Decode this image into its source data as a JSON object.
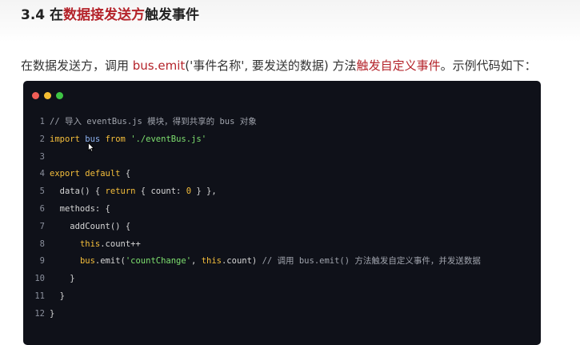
{
  "heading": {
    "prefix": "3.4 在",
    "highlight": "数据接发送方",
    "suffix": "触发事件"
  },
  "paragraph": {
    "part1": "在数据发送方，调用 ",
    "emit": "bus.emit",
    "part2": "('事件名称', 要发送的数据) 方法",
    "accent": "触发自定义事件",
    "part3": "。示例代码如下："
  },
  "colors": {
    "accent": "#b4232a",
    "code_bg": "#0f1119",
    "keyword": "#f6bf3b",
    "string": "#7ee06f",
    "identifier": "#8db2f0"
  },
  "code": {
    "lines": [
      {
        "num": "1",
        "tokens": [
          {
            "t": "// 导入 eventBus.js 模块，得到共享的 bus 对象",
            "c": "comment"
          }
        ]
      },
      {
        "num": "2",
        "tokens": [
          {
            "t": "import",
            "c": "kw"
          },
          {
            "t": " ",
            "c": "plain"
          },
          {
            "t": "bus",
            "c": "bus"
          },
          {
            "t": " ",
            "c": "plain"
          },
          {
            "t": "from",
            "c": "kw"
          },
          {
            "t": " ",
            "c": "plain"
          },
          {
            "t": "'./eventBus.js'",
            "c": "str"
          }
        ]
      },
      {
        "num": "3",
        "tokens": []
      },
      {
        "num": "4",
        "tokens": [
          {
            "t": "export default",
            "c": "kw"
          },
          {
            "t": " {",
            "c": "plain"
          }
        ]
      },
      {
        "num": "5",
        "tokens": [
          {
            "t": "  data() { ",
            "c": "plain"
          },
          {
            "t": "return",
            "c": "kw"
          },
          {
            "t": " { count: ",
            "c": "plain"
          },
          {
            "t": "0",
            "c": "num"
          },
          {
            "t": " } },",
            "c": "plain"
          }
        ]
      },
      {
        "num": "6",
        "tokens": [
          {
            "t": "  methods: {",
            "c": "plain"
          }
        ]
      },
      {
        "num": "7",
        "tokens": [
          {
            "t": "    addCount() {",
            "c": "plain"
          }
        ]
      },
      {
        "num": "8",
        "tokens": [
          {
            "t": "      ",
            "c": "plain"
          },
          {
            "t": "this",
            "c": "kw"
          },
          {
            "t": ".count++",
            "c": "plain"
          }
        ]
      },
      {
        "num": "9",
        "tokens": [
          {
            "t": "      ",
            "c": "plain"
          },
          {
            "t": "bus",
            "c": "kw"
          },
          {
            "t": ".emit(",
            "c": "plain"
          },
          {
            "t": "'countChange'",
            "c": "str"
          },
          {
            "t": ", ",
            "c": "plain"
          },
          {
            "t": "this",
            "c": "kw"
          },
          {
            "t": ".count) ",
            "c": "plain"
          },
          {
            "t": "// 调用 bus.emit() 方法触发自定义事件，并发送数据",
            "c": "comment"
          }
        ]
      },
      {
        "num": "10",
        "tokens": [
          {
            "t": "    }",
            "c": "plain"
          }
        ]
      },
      {
        "num": "11",
        "tokens": [
          {
            "t": "  }",
            "c": "plain"
          }
        ]
      },
      {
        "num": "12",
        "tokens": [
          {
            "t": "}",
            "c": "plain"
          }
        ]
      }
    ]
  },
  "icons": {
    "window_controls": [
      "close-dot-icon",
      "minimize-dot-icon",
      "maximize-dot-icon"
    ],
    "cursor": "mouse-cursor-icon"
  }
}
